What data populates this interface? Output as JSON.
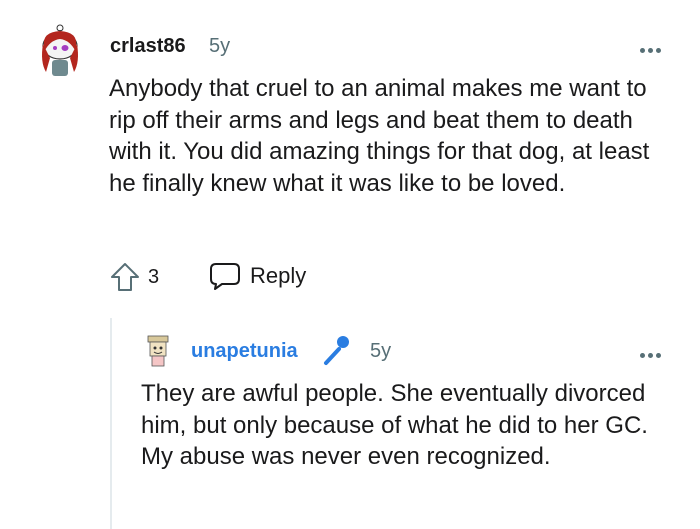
{
  "comment": {
    "username": "crlast86",
    "time": "5y",
    "body": "Anybody that cruel to an animal makes me want to rip off their arms and legs and beat them to death with it. You did amazing things for that dog, at least he finally knew what it was like to be loved.",
    "votes": "3",
    "reply_label": "Reply"
  },
  "reply": {
    "username": "unapetunia",
    "time": "5y",
    "body": "They are awful people. She eventually divorced him, but only because of what he did to her GC. My abuse was never even recognized."
  },
  "colors": {
    "text": "#1a1a1b",
    "meta": "#576f76",
    "op_username": "#2a7de1",
    "thread_line": "#e5ebee"
  },
  "icons": {
    "upvote": "upvote-arrow-icon",
    "reply": "speech-bubble-icon",
    "more": "more-options-icon",
    "mic": "microphone-flair-icon"
  }
}
